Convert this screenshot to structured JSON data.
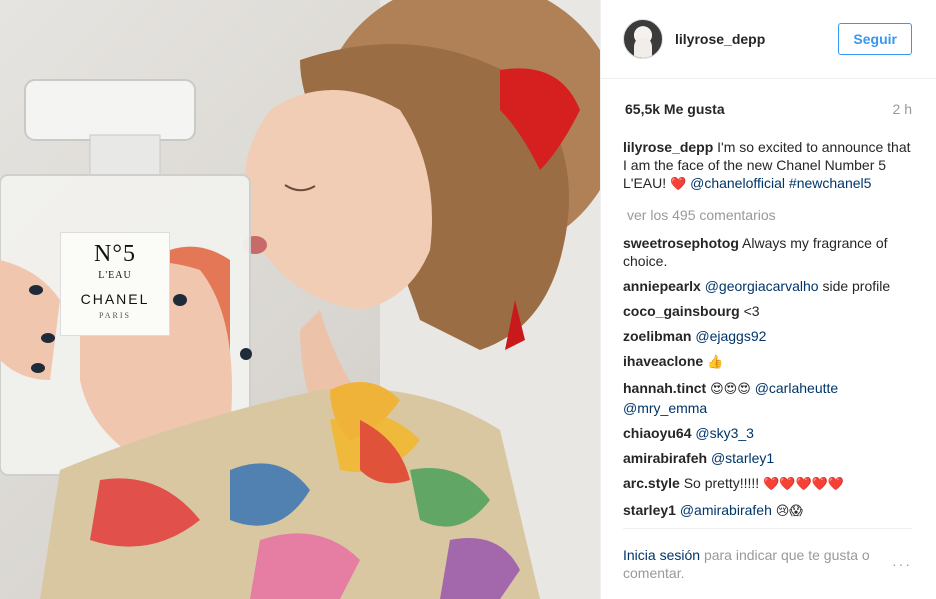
{
  "post": {
    "username": "lilyrose_depp",
    "follow_label": "Seguir",
    "likes": "65,5k Me gusta",
    "time_ago": "2 h",
    "caption": {
      "username": "lilyrose_depp",
      "text": "I'm so excited to announce that I am the face of the new Chanel Number 5 L'EAU!",
      "emoji": "❤️",
      "mention": "@chanelofficial",
      "hashtag": "#newchanel5"
    },
    "view_all_comments": "ver los 495 comentarios",
    "comments": [
      {
        "user": "sweetrosephotog",
        "text": "Always my fragrance of choice."
      },
      {
        "user": "anniepearlx",
        "mention": "@georgiacarvalho",
        "text": "side profile"
      },
      {
        "user": "coco_gainsbourg",
        "text": "<3"
      },
      {
        "user": "zoelibman",
        "mention": "@ejaggs92"
      },
      {
        "user": "ihaveaclone",
        "emoji": "👍"
      },
      {
        "user": "hannah.tinct",
        "emoji": "😍😍😍",
        "mention": "@carlaheutte",
        "mention2": "@mry_emma"
      },
      {
        "user": "chiaoyu64",
        "mention": "@sky3_3"
      },
      {
        "user": "amirabirafeh",
        "mention": "@starley1"
      },
      {
        "user": "arc.style",
        "text": "So pretty!!!!!",
        "emoji": "❤️❤️❤️❤️❤️"
      },
      {
        "user": "starley1",
        "mention": "@amirabirafeh",
        "emoji": "😢😱"
      }
    ],
    "footer": {
      "login_link": "Inicia sesión",
      "text": "para indicar que te gusta o comentar.",
      "more_icon": "···"
    },
    "photo_label": {
      "number": "N°5",
      "subtitle": "L'EAU",
      "brand": "CHANEL",
      "city": "PARIS"
    }
  }
}
